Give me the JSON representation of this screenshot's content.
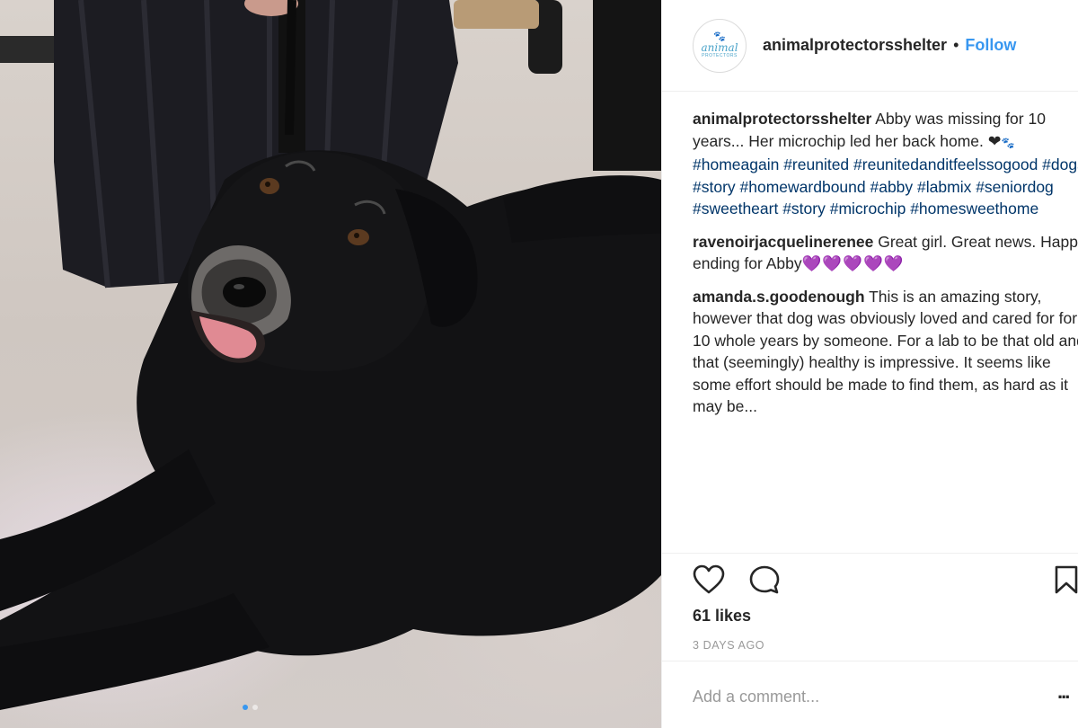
{
  "post": {
    "image_alt": "Black senior lab mix dog lying on the floor",
    "carousel": {
      "count": 2,
      "active_index": 0
    }
  },
  "header": {
    "avatar_logo_text": "animal",
    "avatar_logo_subtext": "PROTECTORS",
    "username": "animalprotectorsshelter",
    "separator": "•",
    "follow_label": "Follow"
  },
  "comments": [
    {
      "user": "animalprotectorsshelter",
      "text": "Abby was missing for 10 years... Her microchip led her back home.",
      "emoji": "❤",
      "emoji2": "🐾",
      "tags": "#homeagain #reunited #reunitedanditfeelssogood #dogs #story #homewardbound #abby #labmix #seniordog #sweetheart #story #microchip #homesweethome"
    },
    {
      "user": "ravenoirjacquelinerenee",
      "text": "Great girl. Great news. Happy ending for Abby",
      "emoji": "💜💜💜💜💜"
    },
    {
      "user": "amanda.s.goodenough",
      "text": "This is an amazing story, however that dog was obviously loved and cared for for 10 whole years by someone. For a lab to be that old and that (seemingly) healthy is impressive. It seems like some effort should be made to find them, as hard as it may be..."
    }
  ],
  "actions": {
    "like_icon": "heart-icon",
    "comment_icon": "comment-icon",
    "save_icon": "bookmark-icon"
  },
  "likes_label": "61 likes",
  "timestamp": "3 DAYS AGO",
  "add_comment": {
    "placeholder": "Add a comment...",
    "more_label": "..."
  },
  "colors": {
    "link": "#3897f0",
    "hashtag": "#003569",
    "muted": "#999999",
    "border": "#efefef"
  }
}
